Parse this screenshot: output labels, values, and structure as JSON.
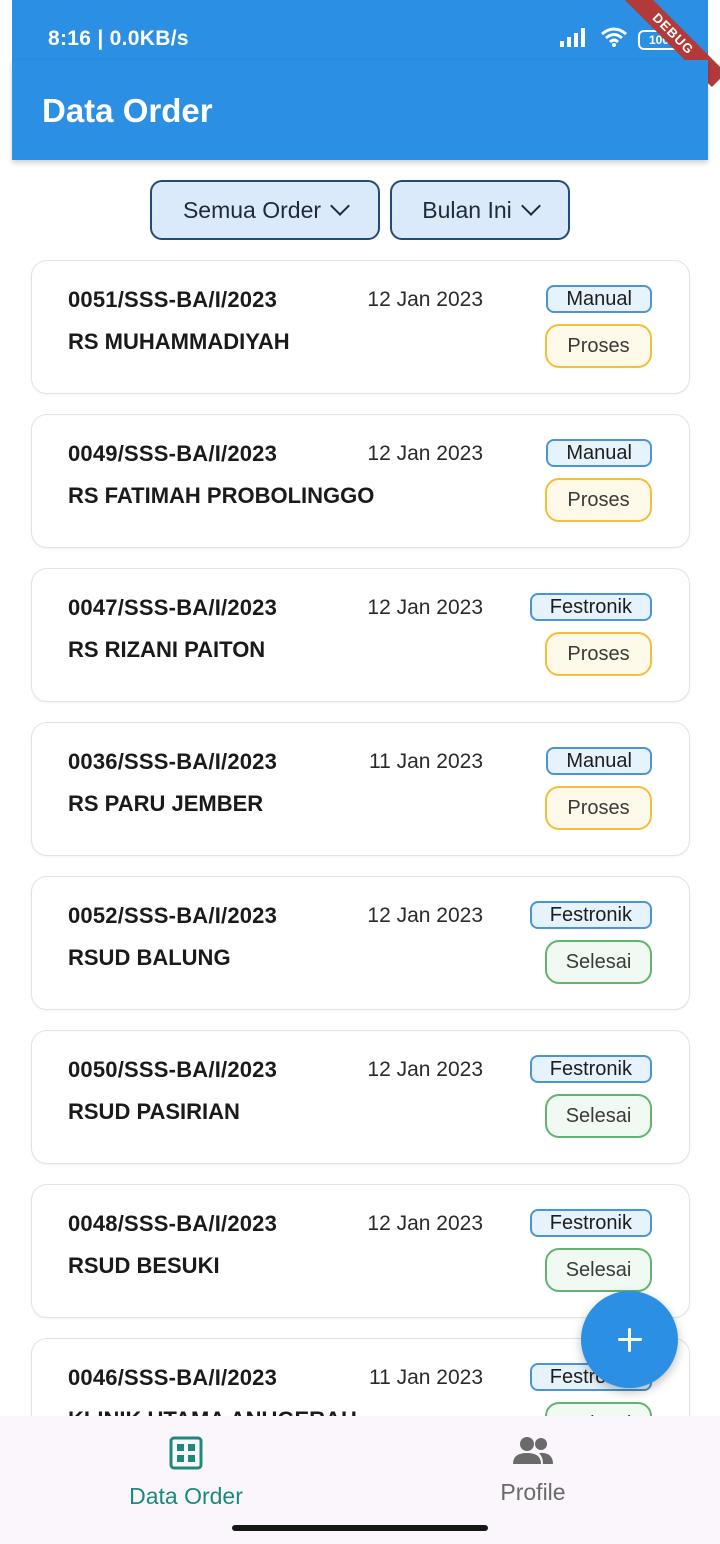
{
  "status_bar": {
    "time": "8:16 | 0.0KB/s",
    "battery": "100",
    "debug_ribbon": "DEBUG"
  },
  "app_bar": {
    "title": "Data Order"
  },
  "filters": [
    {
      "label": "Semua Order"
    },
    {
      "label": "Bulan Ini"
    }
  ],
  "orders": [
    {
      "number": "0051/SSS-BA/I/2023",
      "date": "12 Jan 2023",
      "customer": "RS MUHAMMADIYAH",
      "type": "Manual",
      "status": "Proses"
    },
    {
      "number": "0049/SSS-BA/I/2023",
      "date": "12 Jan 2023",
      "customer": "RS FATIMAH PROBOLINGGO",
      "type": "Manual",
      "status": "Proses"
    },
    {
      "number": "0047/SSS-BA/I/2023",
      "date": "12 Jan 2023",
      "customer": "RS RIZANI PAITON",
      "type": "Festronik",
      "status": "Proses"
    },
    {
      "number": "0036/SSS-BA/I/2023",
      "date": "11 Jan 2023",
      "customer": "RS PARU JEMBER",
      "type": "Manual",
      "status": "Proses"
    },
    {
      "number": "0052/SSS-BA/I/2023",
      "date": "12 Jan 2023",
      "customer": "RSUD BALUNG",
      "type": "Festronik",
      "status": "Selesai"
    },
    {
      "number": "0050/SSS-BA/I/2023",
      "date": "12 Jan 2023",
      "customer": "RSUD PASIRIAN",
      "type": "Festronik",
      "status": "Selesai"
    },
    {
      "number": "0048/SSS-BA/I/2023",
      "date": "12 Jan 2023",
      "customer": "RSUD BESUKI",
      "type": "Festronik",
      "status": "Selesai"
    },
    {
      "number": "0046/SSS-BA/I/2023",
      "date": "11 Jan 2023",
      "customer": "KLINIK UTAMA ANUGERAH",
      "type": "Festronik",
      "status": "Selesai"
    }
  ],
  "fab": {
    "icon": "plus-icon"
  },
  "bottom_nav": [
    {
      "label": "Data Order",
      "icon": "grid-icon",
      "active": true
    },
    {
      "label": "Profile",
      "icon": "people-icon",
      "active": false
    }
  ],
  "colors": {
    "primary": "#2b8fe4",
    "accent": "#1b8a7c",
    "proses": "#f3bf3b",
    "selesai": "#63b36f"
  }
}
